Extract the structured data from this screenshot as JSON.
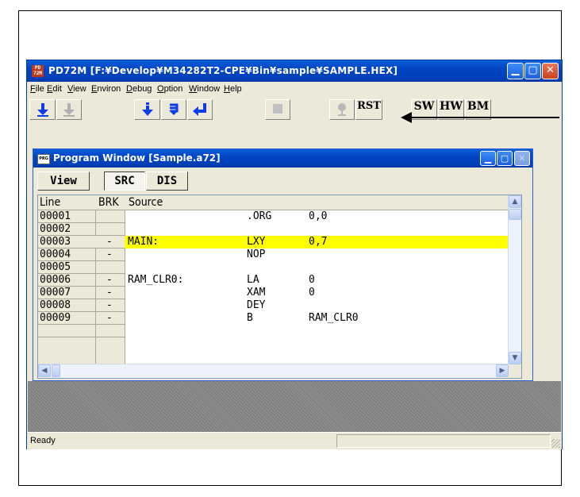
{
  "window": {
    "title": "PD72M [F:¥Develop¥M34282T2-CPE¥Bin¥sample¥SAMPLE.HEX]",
    "icon_text": "PD 72M",
    "controls": [
      "minimize-icon",
      "maximize-icon",
      "close-icon"
    ]
  },
  "menu": [
    {
      "label": "File"
    },
    {
      "label": "Edit"
    },
    {
      "label": "View"
    },
    {
      "label": "Environ"
    },
    {
      "label": "Debug"
    },
    {
      "label": "Option"
    },
    {
      "label": "Window"
    },
    {
      "label": "Help"
    }
  ],
  "toolbar": {
    "download_icon": "download-icon",
    "download_disabled_icon": "download-disabled-icon",
    "step_icon": "step-icon",
    "over_icon": "step-over-icon",
    "return_icon": "return-icon",
    "stop_icon": "stop-icon",
    "run_icon": "go-icon",
    "rst_label": "RST",
    "sw_label": "SW",
    "hw_label": "HW",
    "bm_label": "BM"
  },
  "program_window": {
    "title": "Program Window [Sample.a72]",
    "icon_text": "PRG",
    "view_label": "View",
    "src_label": "SRC",
    "dis_label": "DIS",
    "columns": {
      "line": "Line",
      "brk": "BRK",
      "source": "Source"
    },
    "rows": [
      {
        "line": "00001",
        "brk": "",
        "label": "",
        "op": ".ORG",
        "arg": "0,0",
        "highlight": false
      },
      {
        "line": "00002",
        "brk": "",
        "label": "",
        "op": "",
        "arg": "",
        "highlight": false
      },
      {
        "line": "00003",
        "brk": "-",
        "label": "MAIN:",
        "op": "LXY",
        "arg": "0,7",
        "highlight": true
      },
      {
        "line": "00004",
        "brk": "-",
        "label": "",
        "op": "NOP",
        "arg": "",
        "highlight": false
      },
      {
        "line": "00005",
        "brk": "",
        "label": "",
        "op": "",
        "arg": "",
        "highlight": false
      },
      {
        "line": "00006",
        "brk": "-",
        "label": "RAM_CLR0:",
        "op": "LA",
        "arg": "0",
        "highlight": false
      },
      {
        "line": "00007",
        "brk": "-",
        "label": "",
        "op": "XAM",
        "arg": "0",
        "highlight": false
      },
      {
        "line": "00008",
        "brk": "-",
        "label": "",
        "op": "DEY",
        "arg": "",
        "highlight": false
      },
      {
        "line": "00009",
        "brk": "-",
        "label": "",
        "op": "B",
        "arg": "RAM_CLR0",
        "highlight": false
      }
    ]
  },
  "status": {
    "text": "Ready"
  },
  "colors": {
    "highlight": "#ffff00",
    "titlebar": "#0344c4",
    "face": "#ece9d8"
  }
}
